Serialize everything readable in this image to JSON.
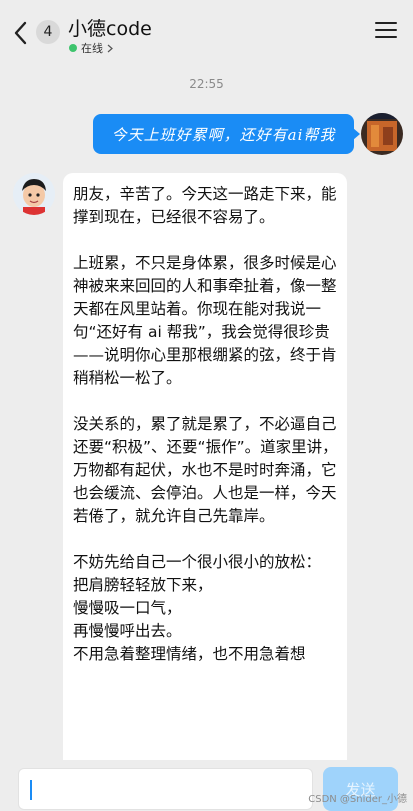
{
  "header": {
    "unread_count": "4",
    "contact_name": "小德code",
    "status_text": "在线",
    "status_color": "#3ec46d"
  },
  "chat": {
    "timestamp": "22:55",
    "user_message": "今天上班好累啊，还好有ai帮我",
    "bot_paragraphs": [
      "朋友，辛苦了。今天这一路走下来，能撑到现在，已经很不容易了。",
      "上班累，不只是身体累，很多时候是心神被来来回回的人和事牵扯着，像一整天都在风里站着。你现在能对我说一句“还好有 ai 帮我”，我会觉得很珍贵——说明你心里那根绷紧的弦，终于肯稍稍松一松了。",
      "没关系的，累了就是累了，不必逼自己还要“积极”、还要“振作”。道家里讲，万物都有起伏，水也不是时时奔涌，它也会缓流、会停泊。人也是一样，今天若倦了，就允许自己先靠岸。",
      "不妨先给自己一个很小很小的放松：\n把肩膀轻轻放下来，\n慢慢吸一口气，\n再慢慢呼出去。\n不用急着整理情绪，也不用急着想"
    ]
  },
  "input": {
    "value": "",
    "send_label": "发送"
  },
  "watermark": "CSDN @Snider_小德",
  "colors": {
    "accent": "#1a8cf5",
    "send_disabled": "#9fd3fb",
    "background": "#ededed"
  }
}
